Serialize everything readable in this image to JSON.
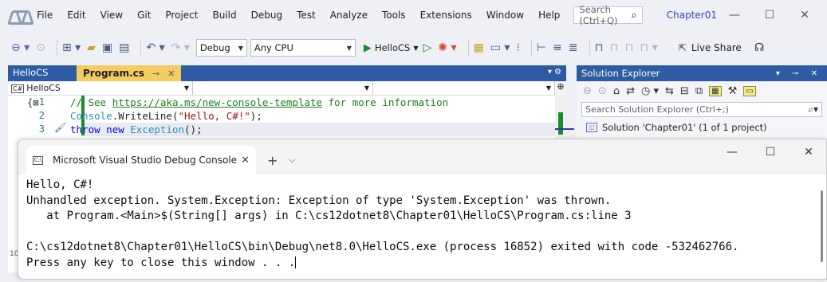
{
  "menubar": {
    "items": [
      "File",
      "Edit",
      "View",
      "Git",
      "Project",
      "Build",
      "Debug",
      "Test",
      "Analyze",
      "Tools",
      "Extensions",
      "Window",
      "Help"
    ],
    "search_placeholder": "Search (Ctrl+Q)",
    "solution_name": "Chapter01"
  },
  "toolbar": {
    "configuration": "Debug",
    "platform": "Any CPU",
    "run_target": "HelloCS",
    "live_share": "Live Share"
  },
  "editor": {
    "project_tab": "HelloCS",
    "file_tab": "Program.cs",
    "nav_project": "HelloCS",
    "lines": [
      {
        "num": "1",
        "comment_prefix": "// See ",
        "link": "https://aka.ms/new-console-template",
        "comment_suffix": " for more information"
      },
      {
        "num": "2",
        "type": "Console",
        "method": ".WriteLine(",
        "string": "\"Hello, C#!\"",
        "end": ");"
      },
      {
        "num": "3",
        "keyword1": "throw",
        "keyword2": "new",
        "type": "Exception",
        "end": "();"
      }
    ]
  },
  "solution_explorer": {
    "title": "Solution Explorer",
    "search_placeholder": "Search Solution Explorer (Ctrl+;)",
    "solution_label": "Solution 'Chapter01' (1 of 1 project)"
  },
  "console": {
    "tab_title": "Microsoft Visual Studio Debug Console",
    "lines": [
      "Hello, C#!",
      "Unhandled exception. System.Exception: Exception of type 'System.Exception' was thrown.",
      "   at Program.<Main>$(String[] args) in C:\\cs12dotnet8\\Chapter01\\HelloCS\\Program.cs:line 3",
      "",
      "C:\\cs12dotnet8\\Chapter01\\HelloCS\\bin\\Debug\\net8.0\\HelloCS.exe (process 16852) exited with code -532462766.",
      "Press any key to close this window . . ."
    ]
  },
  "peek_line_number": "10"
}
